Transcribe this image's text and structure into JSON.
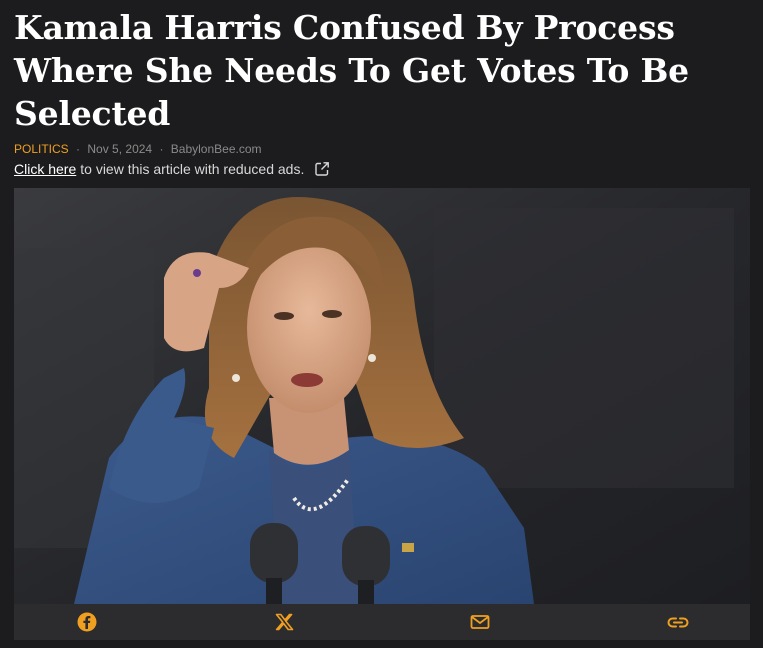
{
  "article": {
    "title": "Kamala Harris Confused By Process Where She Needs To Get Votes To Be Selected",
    "category": "POLITICS",
    "date": "Nov 5, 2024",
    "source": "BabylonBee.com",
    "separator": "·"
  },
  "reduced_ads": {
    "link_text": "Click here",
    "rest_text": "to view this article with reduced ads.",
    "icon": "external-link-icon"
  },
  "image": {
    "subject": "photo"
  },
  "share": {
    "icons": [
      "facebook-icon",
      "x-icon",
      "email-icon",
      "copy-link-icon"
    ],
    "accent_color": "#f0a020"
  },
  "colors": {
    "background": "#1c1c1e",
    "category": "#f0a020",
    "headline": "#ffffff",
    "share_bar": "#2c2c2e"
  }
}
